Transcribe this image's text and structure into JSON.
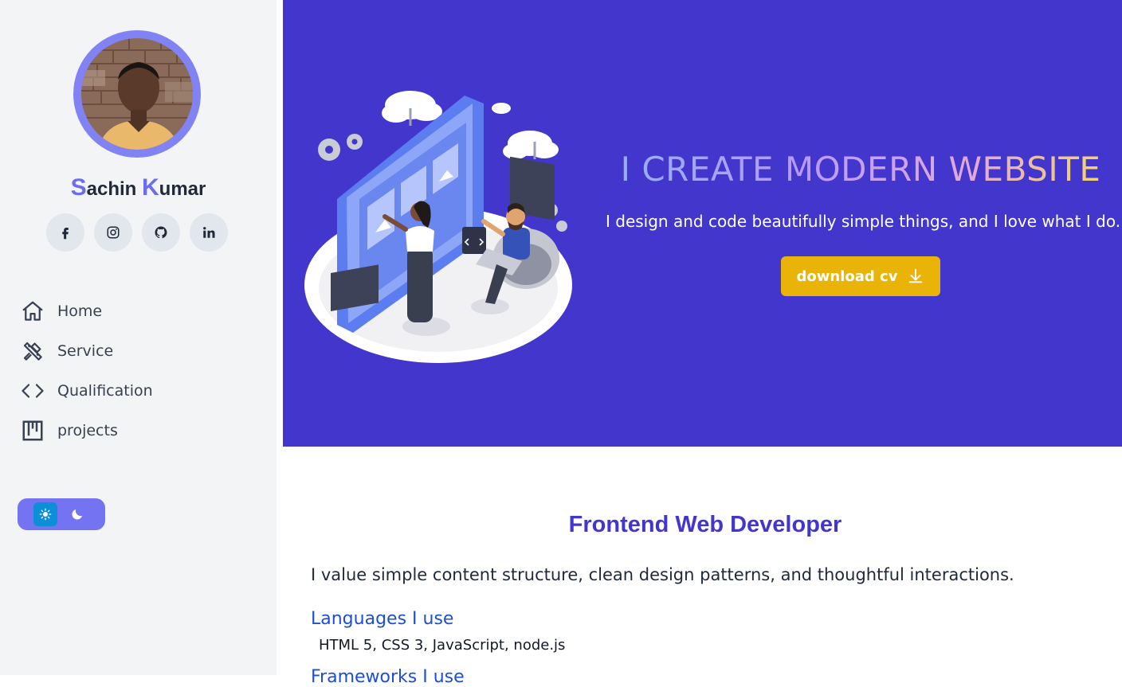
{
  "sidebar": {
    "avatar_alt": "profile photo",
    "name": {
      "first_initial": "S",
      "first_rest": "achin ",
      "last_initial": "K",
      "last_rest": "umar"
    },
    "social": [
      {
        "icon": "facebook-icon"
      },
      {
        "icon": "instagram-icon"
      },
      {
        "icon": "github-icon"
      },
      {
        "icon": "linkedin-icon"
      }
    ],
    "nav": [
      {
        "label": "Home",
        "icon": "home-icon"
      },
      {
        "label": "Service",
        "icon": "tools-icon"
      },
      {
        "label": "Qualification",
        "icon": "code-icon"
      },
      {
        "label": "projects",
        "icon": "kanban-icon"
      }
    ],
    "theme_toggle": {
      "light_icon": "sun-icon",
      "dark_icon": "moon-icon"
    }
  },
  "hero": {
    "title": "I CREATE MODERN WEBSITE",
    "subtitle": "I design and code beautifully simple things, and I love what I do.",
    "download_label": "download cv"
  },
  "about": {
    "title": "Frontend Web Developer",
    "text": "I value simple content structure, clean design patterns, and thoughtful interactions.",
    "languages_heading": "Languages I use",
    "languages": "HTML 5, CSS 3, JavaScript, node.js",
    "frameworks_heading": "Frameworks I use"
  },
  "colors": {
    "accent": "#4336cc",
    "avatar_ring": "#8183f4",
    "button": "#eab308",
    "sidebar_bg": "#f3f4f6"
  }
}
